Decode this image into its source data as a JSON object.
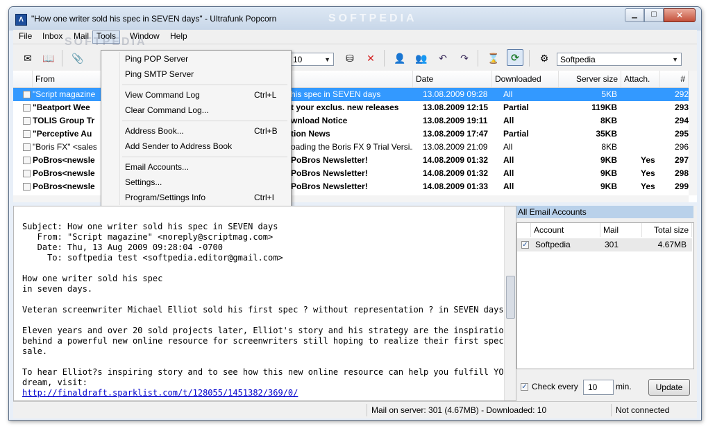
{
  "window": {
    "title": "\"How one writer sold his spec in SEVEN days\" - Ultrafunk Popcorn",
    "app_icon": "Λ",
    "controls": {
      "minimize": "▁",
      "maximize": "☐",
      "close": "✕"
    }
  },
  "watermark": "SOFTPEDIA",
  "menubar": {
    "items": [
      "File",
      "Inbox",
      "Mail",
      "Tools",
      "Window",
      "Help"
    ],
    "active": "Tools"
  },
  "toolbar": {
    "count_value": "10",
    "account_value": "Softpedia",
    "icons": [
      "new-mail-icon",
      "address-book-icon",
      "attach-icon",
      "reply-icon",
      "forward-icon",
      "filter-icon",
      "delete-icon",
      "user-icon",
      "users-icon",
      "reply-all-icon",
      "forward-all-icon",
      "hourglass-icon",
      "check-mail-icon",
      "settings-icon"
    ],
    "arrow": "▼"
  },
  "tools_menu": {
    "items": [
      {
        "label": "Ping POP Server",
        "shortcut": ""
      },
      {
        "label": "Ping SMTP Server",
        "shortcut": ""
      },
      {
        "label": "View Command Log",
        "shortcut": "Ctrl+L"
      },
      {
        "label": "Clear Command Log...",
        "shortcut": ""
      },
      {
        "label": "Address Book...",
        "shortcut": "Ctrl+B"
      },
      {
        "label": "Add Sender to Address Book",
        "shortcut": ""
      },
      {
        "label": "Email Accounts...",
        "shortcut": ""
      },
      {
        "label": "Settings...",
        "shortcut": ""
      },
      {
        "label": "Program/Settings Info",
        "shortcut": "Ctrl+I"
      }
    ]
  },
  "message_list": {
    "columns": [
      "From",
      "Date",
      "Downloaded",
      "Server size",
      "Attach.",
      "#"
    ],
    "rows": [
      {
        "from": "\"Script magazine",
        "subject": "his spec in SEVEN days",
        "date": "13.08.2009 09:28",
        "downloaded": "All",
        "size": "5KB",
        "attach": "",
        "num": "292",
        "selected": true,
        "bold": false
      },
      {
        "from": "\"Beatport Wee",
        "subject": "t your exclus. new releases",
        "date": "13.08.2009 12:15",
        "downloaded": "Partial",
        "size": "119KB",
        "attach": "",
        "num": "293",
        "selected": false,
        "bold": true
      },
      {
        "from": "TOLIS Group Tr",
        "subject": "wnload Notice",
        "date": "13.08.2009 19:11",
        "downloaded": "All",
        "size": "8KB",
        "attach": "",
        "num": "294",
        "selected": false,
        "bold": true
      },
      {
        "from": "\"Perceptive Au",
        "subject": "tion News",
        "date": "13.08.2009 17:47",
        "downloaded": "Partial",
        "size": "35KB",
        "attach": "",
        "num": "295",
        "selected": false,
        "bold": true
      },
      {
        "from": "\"Boris FX\" <sales",
        "subject": "oading the Boris FX 9 Trial Versi...",
        "date": "13.08.2009 21:09",
        "downloaded": "All",
        "size": "8KB",
        "attach": "",
        "num": "296",
        "selected": false,
        "bold": false
      },
      {
        "from": "PoBros<newsle",
        "subject": "PoBros Newsletter!",
        "date": "14.08.2009 01:32",
        "downloaded": "All",
        "size": "9KB",
        "attach": "Yes",
        "num": "297",
        "selected": false,
        "bold": true
      },
      {
        "from": "PoBros<newsle",
        "subject": "PoBros Newsletter!",
        "date": "14.08.2009 01:32",
        "downloaded": "All",
        "size": "9KB",
        "attach": "Yes",
        "num": "298",
        "selected": false,
        "bold": true
      },
      {
        "from": "PoBros<newsle",
        "subject": "PoBros Newsletter!",
        "date": "14.08.2009 01:33",
        "downloaded": "All",
        "size": "9KB",
        "attach": "Yes",
        "num": "299",
        "selected": false,
        "bold": true
      }
    ]
  },
  "preview": {
    "header_lines": [
      "Subject: How one writer sold his spec in SEVEN days",
      "   From: \"Script magazine\" <noreply@scriptmag.com>",
      "   Date: Thu, 13 Aug 2009 09:28:04 -0700",
      "     To: softpedia test <softpedia.editor@gmail.com>"
    ],
    "body_lines": [
      "",
      "How one writer sold his spec",
      "in seven days.",
      "",
      "Veteran screenwriter Michael Elliot sold his first spec ? without representation ? in SEVEN days.",
      "",
      "Eleven years and over 20 sold projects later, Elliot's story and his strategy are the inspiration",
      "behind a powerful new online resource for screenwriters still hoping to realize their first spec",
      "sale.",
      "",
      "To hear Elliot?s inspiring story and to see how this new online resource can help you fulfill YOUR",
      "dream, visit:"
    ],
    "link": "http://finaldraft.sparklist.com/t/128055/1451382/369/0/"
  },
  "accounts_panel": {
    "title": "All Email Accounts",
    "columns": [
      "Account",
      "Mail",
      "Total size"
    ],
    "rows": [
      {
        "account": "Softpedia",
        "mail": "301",
        "size": "4.67MB",
        "checked": true
      }
    ],
    "check_every_label": "Check every",
    "check_every_value": "10",
    "min_label": "min.",
    "update_label": "Update",
    "check_mark": "✓"
  },
  "statusbar": {
    "mail_info": "Mail on server: 301 (4.67MB) - Downloaded: 10",
    "connection": "Not connected"
  }
}
